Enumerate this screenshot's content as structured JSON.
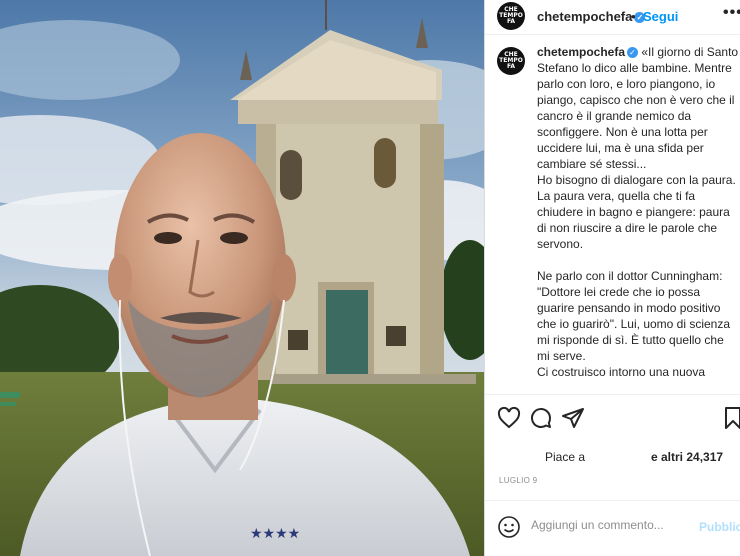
{
  "post": {
    "username": "chetempochefa",
    "avatar_text": "CHE\nTEMPO\nFA",
    "follow_label": "Segui",
    "dot": "•",
    "more_label": "•••",
    "caption_user": "chetempochefa",
    "caption_text": " «Il giorno di Santo Stefano lo dico alle bambine. Mentre parlo con loro, e loro piangono, io piango, capisco che non è vero che il cancro è il grande nemico da sconfiggere. Non è una lotta per uccidere lui, ma è una sfida per cambiare sé stessi...\nHo bisogno di dialogare con la paura. La paura vera, quella che ti fa chiudere in bagno e piangere: paura di non riuscire a dire le parole che servono.\n\nNe parlo con il dottor Cunningham: \"Dottore lei crede che io possa guarire pensando in modo positivo che io guarirò\". Lui, uomo di scienza mi risponde di sì. È tutto quello che mi serve.\nCi costruisco intorno una nuova",
    "likes_prefix": "Piace a",
    "likes_suffix": "e altri 24,317",
    "date": "LUGLIO 9",
    "comment_placeholder": "Aggiungi un commento...",
    "publish_label": "Pubblica"
  },
  "icons": [
    "heart-icon",
    "comment-icon",
    "share-icon",
    "bookmark-icon",
    "emoji-icon",
    "verified-icon"
  ],
  "colors": {
    "accent": "#0095f6",
    "verified": "#3897f0",
    "publish_disabled": "#b2dffc",
    "muted": "#8e8e8e"
  }
}
